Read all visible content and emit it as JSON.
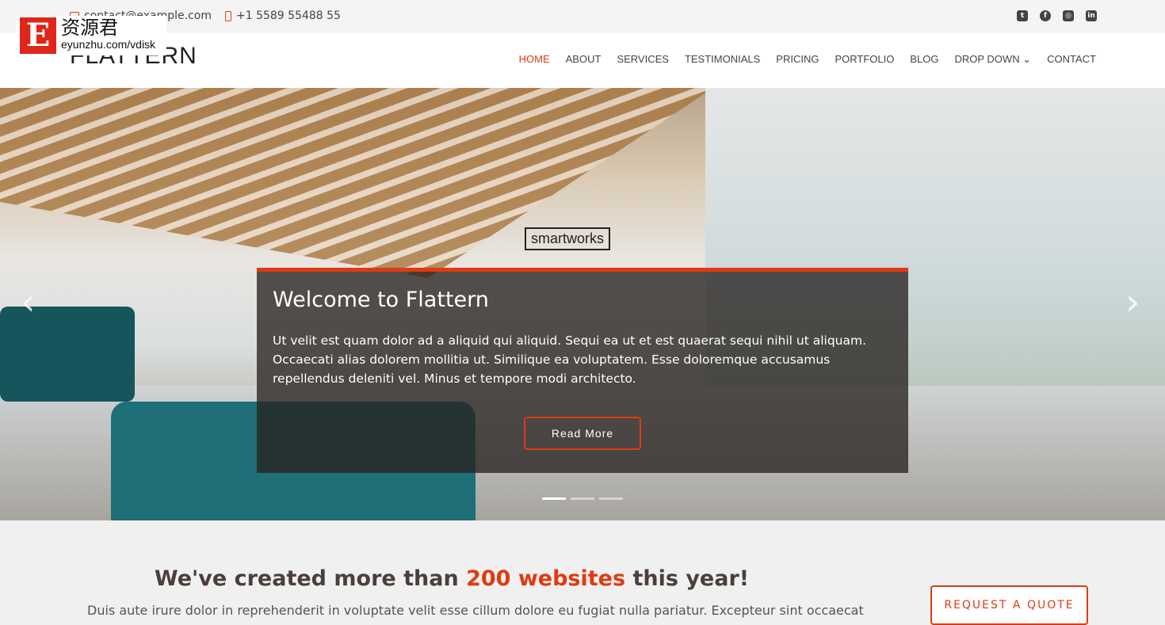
{
  "topbar": {
    "email": "contact@example.com",
    "phone": "+1 5589 55488 55",
    "social": [
      "twitter-icon",
      "facebook-icon",
      "instagram-icon",
      "linkedin-icon"
    ]
  },
  "watermark": {
    "letter": "E",
    "title": "资源君",
    "url": "eyunzhu.com/vdisk"
  },
  "header": {
    "logo": "FLATTERN",
    "nav": [
      "HOME",
      "ABOUT",
      "SERVICES",
      "TESTIMONIALS",
      "PRICING",
      "PORTFOLIO",
      "BLOG",
      "DROP DOWN",
      "CONTACT"
    ],
    "active": "HOME"
  },
  "hero": {
    "sign": "smartworks",
    "title": "Welcome to Flattern",
    "text": "Ut velit est quam dolor ad a aliquid qui aliquid. Sequi ea ut et est quaerat sequi nihil ut aliquam. Occaecati alias dolorem mollitia ut. Similique ea voluptatem. Esse doloremque accusamus repellendus deleniti vel. Minus et tempore modi architecto.",
    "button": "Read More",
    "slides": 3,
    "active_slide": 1
  },
  "cta": {
    "title_pre": "We've created more than ",
    "title_em": "200 websites",
    "title_post": " this year!",
    "text": "Duis aute irure dolor in reprehenderit in voluptate velit esse cillum dolore eu fugiat nulla pariatur. Excepteur sint occaecat",
    "button": "REQUEST A QUOTE"
  },
  "colors": {
    "accent": "#e03a12"
  }
}
